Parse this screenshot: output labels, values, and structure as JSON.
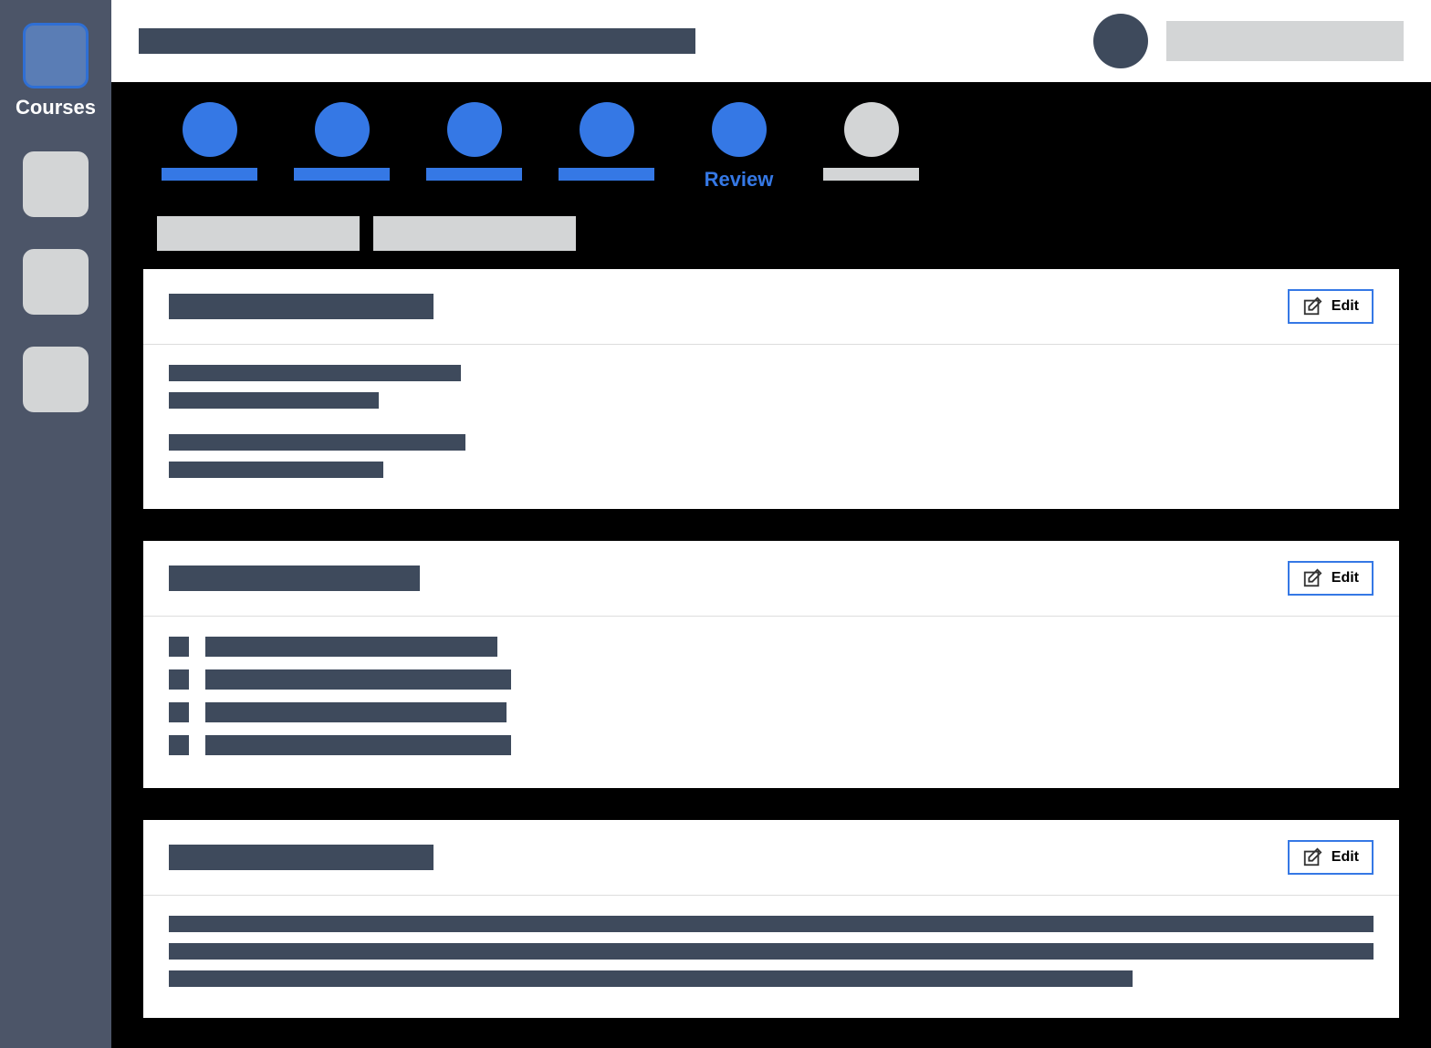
{
  "sidebar": {
    "items": [
      {
        "label": "Courses",
        "active": true
      },
      {
        "label": "",
        "active": false
      },
      {
        "label": "",
        "active": false
      },
      {
        "label": "",
        "active": false
      }
    ]
  },
  "header": {
    "title": "",
    "user_name": ""
  },
  "stepper": {
    "steps": [
      {
        "label": "",
        "state": "active"
      },
      {
        "label": "",
        "state": "active"
      },
      {
        "label": "",
        "state": "active"
      },
      {
        "label": "",
        "state": "active"
      },
      {
        "label": "Review",
        "state": "active"
      },
      {
        "label": "",
        "state": "inactive"
      }
    ]
  },
  "sub_tabs": {
    "tab1": "",
    "tab2": ""
  },
  "cards": {
    "card1": {
      "title": "",
      "edit_label": "Edit",
      "lines": [
        "",
        "",
        "",
        ""
      ]
    },
    "card2": {
      "title": "",
      "edit_label": "Edit",
      "items": [
        "",
        "",
        "",
        ""
      ]
    },
    "card3": {
      "title": "",
      "edit_label": "Edit",
      "lines": [
        "",
        "",
        ""
      ]
    }
  }
}
